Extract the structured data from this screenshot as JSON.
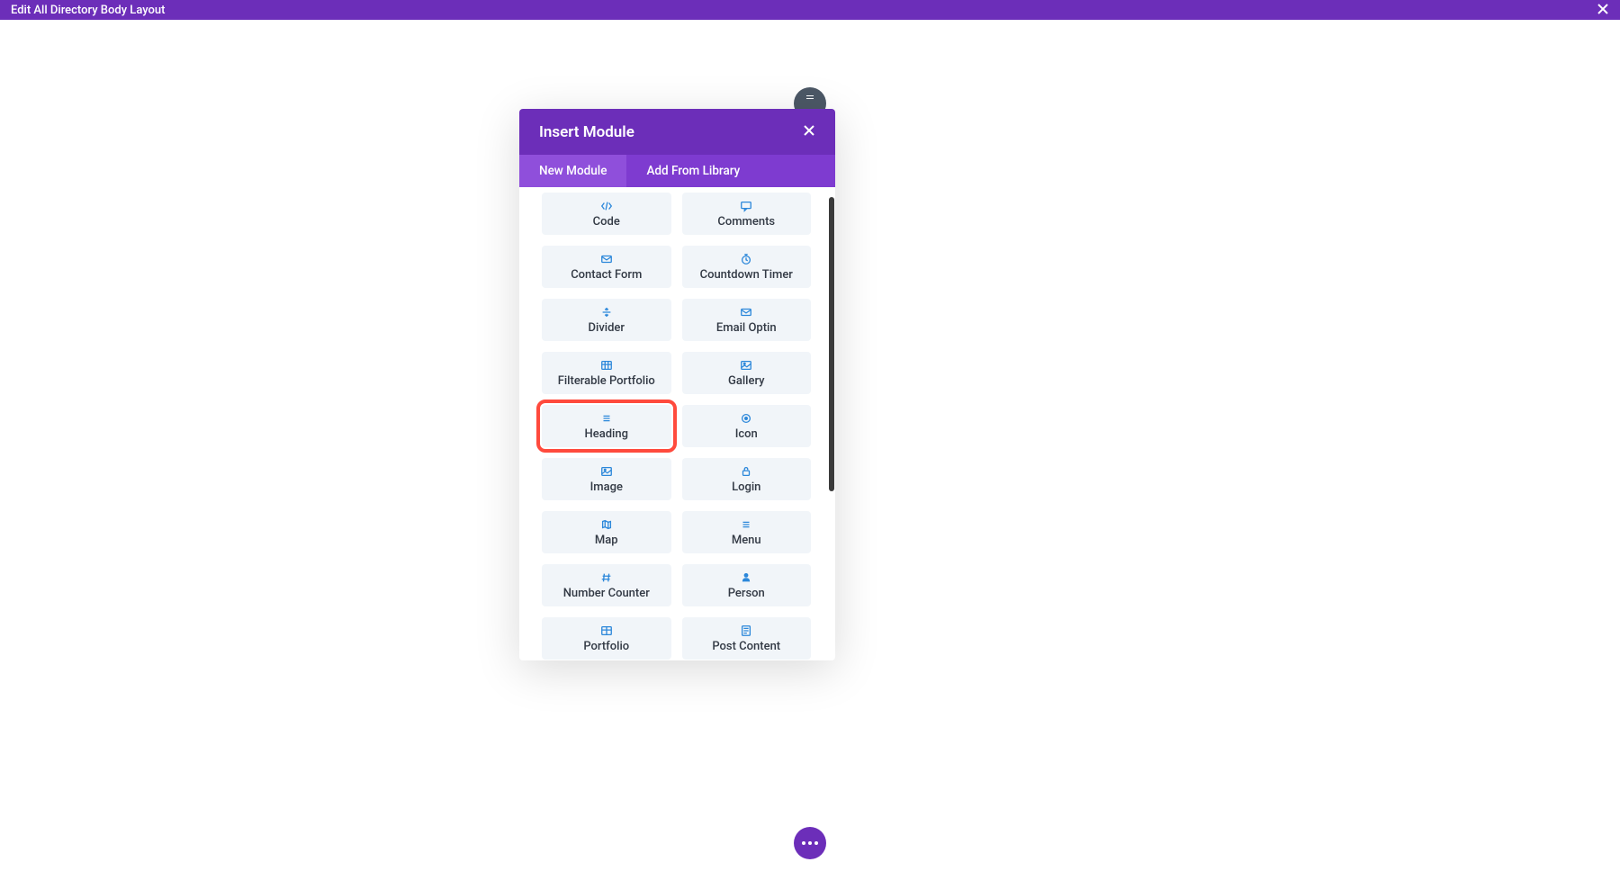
{
  "topBar": {
    "title": "Edit All Directory Body Layout"
  },
  "modal": {
    "title": "Insert Module",
    "tabs": {
      "new": "New Module",
      "library": "Add From Library"
    },
    "modules": {
      "code": "Code",
      "comments": "Comments",
      "contactForm": "Contact Form",
      "countdownTimer": "Countdown Timer",
      "divider": "Divider",
      "emailOptin": "Email Optin",
      "filterablePortfolio": "Filterable Portfolio",
      "gallery": "Gallery",
      "heading": "Heading",
      "icon": "Icon",
      "image": "Image",
      "login": "Login",
      "map": "Map",
      "menu": "Menu",
      "numberCounter": "Number Counter",
      "person": "Person",
      "portfolio": "Portfolio",
      "postContent": "Post Content"
    }
  }
}
